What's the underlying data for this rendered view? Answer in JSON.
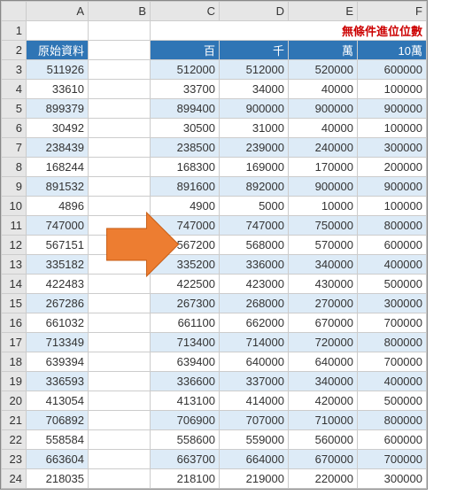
{
  "columns": [
    "A",
    "B",
    "C",
    "D",
    "E",
    "F"
  ],
  "title": "無條件進位位數",
  "headers": {
    "A": "原始資料",
    "C": "百",
    "D": "千",
    "E": "萬",
    "F": "10萬"
  },
  "rows": [
    {
      "A": 511926,
      "C": 512000,
      "D": 512000,
      "E": 520000,
      "F": 600000
    },
    {
      "A": 33610,
      "C": 33700,
      "D": 34000,
      "E": 40000,
      "F": 100000
    },
    {
      "A": 899379,
      "C": 899400,
      "D": 900000,
      "E": 900000,
      "F": 900000
    },
    {
      "A": 30492,
      "C": 30500,
      "D": 31000,
      "E": 40000,
      "F": 100000
    },
    {
      "A": 238439,
      "C": 238500,
      "D": 239000,
      "E": 240000,
      "F": 300000
    },
    {
      "A": 168244,
      "C": 168300,
      "D": 169000,
      "E": 170000,
      "F": 200000
    },
    {
      "A": 891532,
      "C": 891600,
      "D": 892000,
      "E": 900000,
      "F": 900000
    },
    {
      "A": 4896,
      "C": 4900,
      "D": 5000,
      "E": 10000,
      "F": 100000
    },
    {
      "A": 747000,
      "C": 747000,
      "D": 747000,
      "E": 750000,
      "F": 800000
    },
    {
      "A": 567151,
      "C": 567200,
      "D": 568000,
      "E": 570000,
      "F": 600000
    },
    {
      "A": 335182,
      "C": 335200,
      "D": 336000,
      "E": 340000,
      "F": 400000
    },
    {
      "A": 422483,
      "C": 422500,
      "D": 423000,
      "E": 430000,
      "F": 500000
    },
    {
      "A": 267286,
      "C": 267300,
      "D": 268000,
      "E": 270000,
      "F": 300000
    },
    {
      "A": 661032,
      "C": 661100,
      "D": 662000,
      "E": 670000,
      "F": 700000
    },
    {
      "A": 713349,
      "C": 713400,
      "D": 714000,
      "E": 720000,
      "F": 800000
    },
    {
      "A": 639394,
      "C": 639400,
      "D": 640000,
      "E": 640000,
      "F": 700000
    },
    {
      "A": 336593,
      "C": 336600,
      "D": 337000,
      "E": 340000,
      "F": 400000
    },
    {
      "A": 413054,
      "C": 413100,
      "D": 414000,
      "E": 420000,
      "F": 500000
    },
    {
      "A": 706892,
      "C": 706900,
      "D": 707000,
      "E": 710000,
      "F": 800000
    },
    {
      "A": 558584,
      "C": 558600,
      "D": 559000,
      "E": 560000,
      "F": 600000
    },
    {
      "A": 663604,
      "C": 663700,
      "D": 664000,
      "E": 670000,
      "F": 700000
    },
    {
      "A": 218035,
      "C": 218100,
      "D": 219000,
      "E": 220000,
      "F": 300000
    }
  ],
  "chart_data": {
    "type": "table",
    "title": "無條件進位位數",
    "columns": [
      "原始資料",
      "百",
      "千",
      "萬",
      "10萬"
    ],
    "data": [
      [
        511926,
        512000,
        512000,
        520000,
        600000
      ],
      [
        33610,
        33700,
        34000,
        40000,
        100000
      ],
      [
        899379,
        899400,
        900000,
        900000,
        900000
      ],
      [
        30492,
        30500,
        31000,
        40000,
        100000
      ],
      [
        238439,
        238500,
        239000,
        240000,
        300000
      ],
      [
        168244,
        168300,
        169000,
        170000,
        200000
      ],
      [
        891532,
        891600,
        892000,
        900000,
        900000
      ],
      [
        4896,
        4900,
        5000,
        10000,
        100000
      ],
      [
        747000,
        747000,
        747000,
        750000,
        800000
      ],
      [
        567151,
        567200,
        568000,
        570000,
        600000
      ],
      [
        335182,
        335200,
        336000,
        340000,
        400000
      ],
      [
        422483,
        422500,
        423000,
        430000,
        500000
      ],
      [
        267286,
        267300,
        268000,
        270000,
        300000
      ],
      [
        661032,
        661100,
        662000,
        670000,
        700000
      ],
      [
        713349,
        713400,
        714000,
        720000,
        800000
      ],
      [
        639394,
        639400,
        640000,
        640000,
        700000
      ],
      [
        336593,
        336600,
        337000,
        340000,
        400000
      ],
      [
        413054,
        413100,
        414000,
        420000,
        500000
      ],
      [
        706892,
        706900,
        707000,
        710000,
        800000
      ],
      [
        558584,
        558600,
        559000,
        560000,
        600000
      ],
      [
        663604,
        663700,
        664000,
        670000,
        700000
      ],
      [
        218035,
        218100,
        219000,
        220000,
        300000
      ]
    ]
  }
}
